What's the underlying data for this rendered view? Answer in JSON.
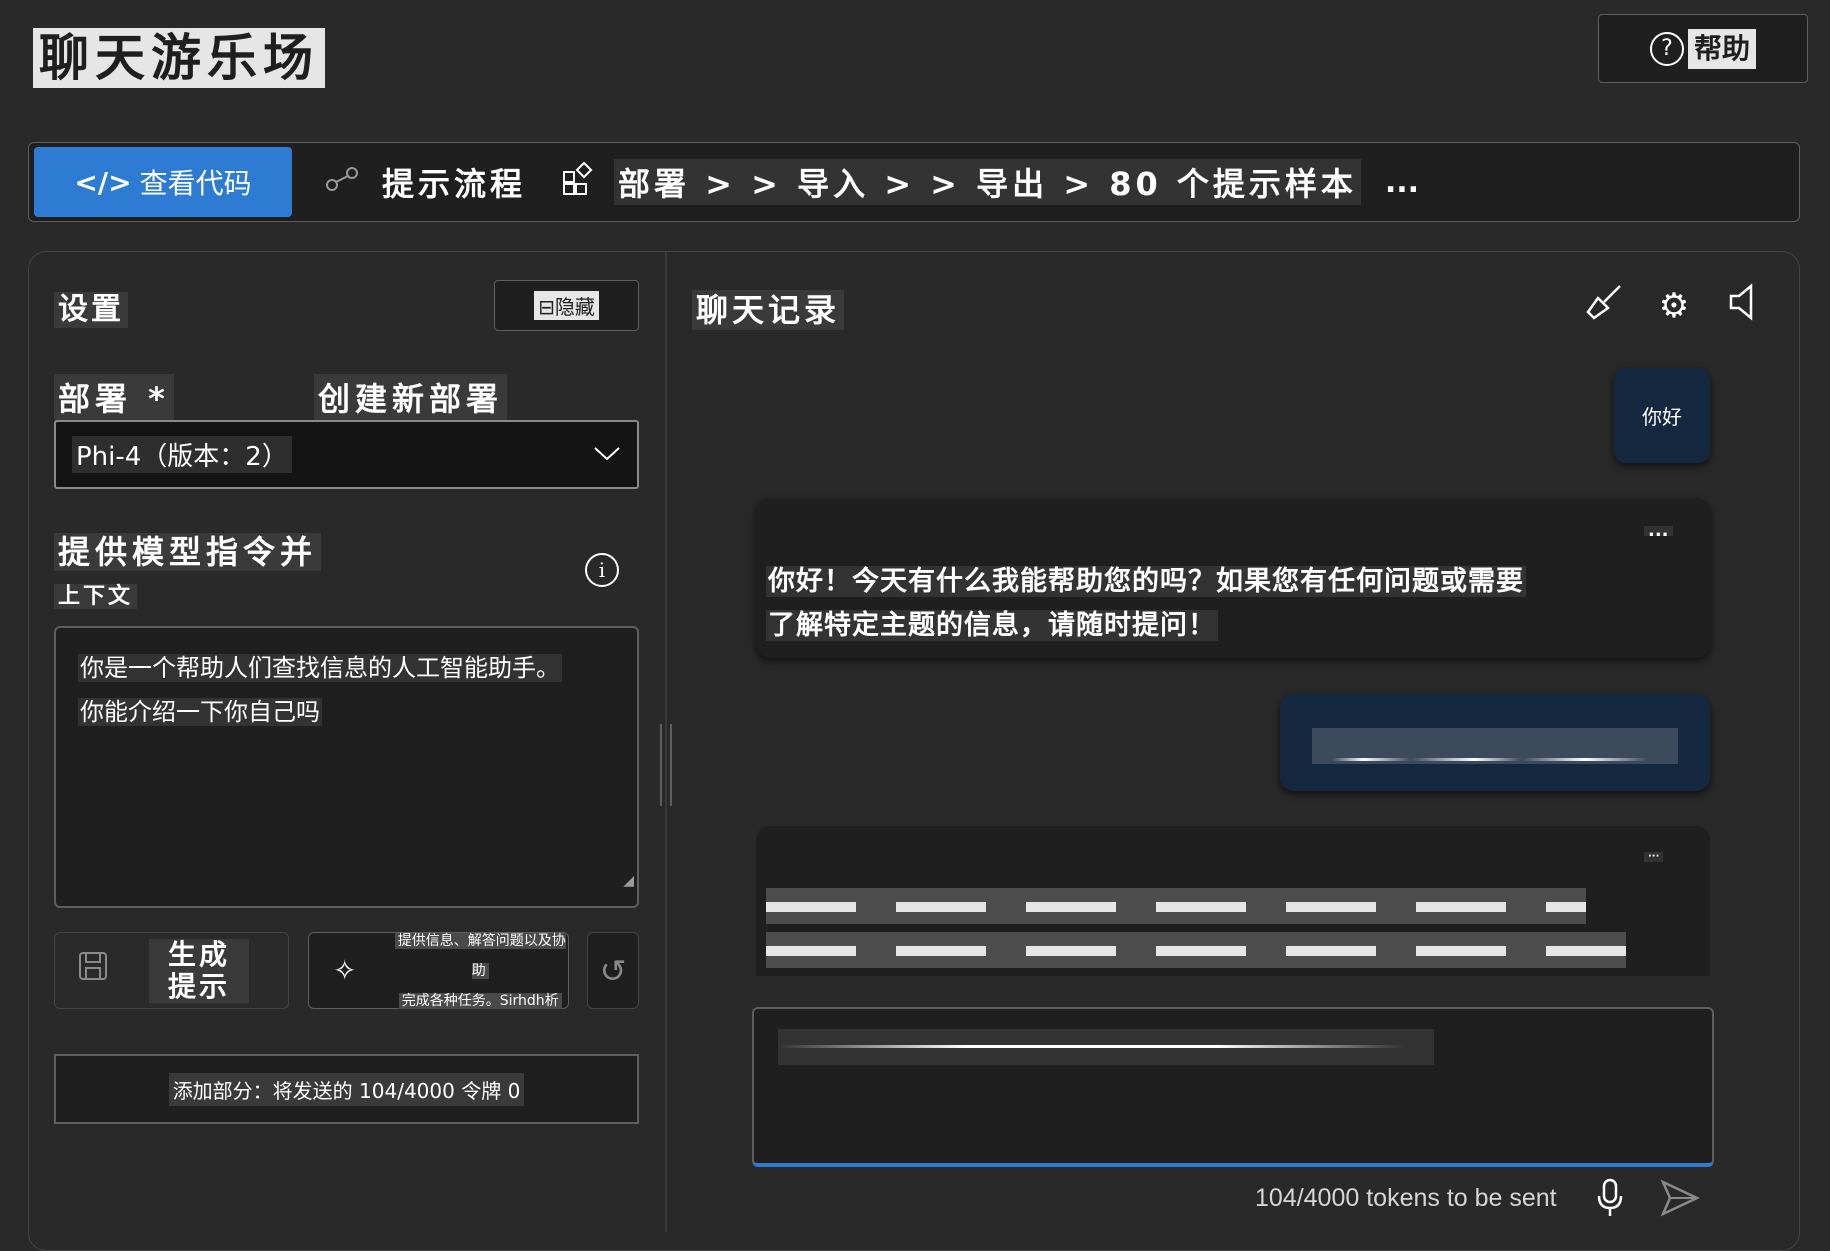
{
  "header": {
    "title": "聊天游乐场",
    "help_label": "帮助"
  },
  "toolbar": {
    "view_code_label": "查看代码",
    "code_glyph": "</>",
    "prompt_flow_label": "提示流程",
    "deploy_chain_label": "部署 > > 导入 > > 导出 > 80 个提示样本",
    "more_label": "..."
  },
  "settings": {
    "title": "设置",
    "hide_label": "隐藏",
    "deployment_label": "部署 *",
    "create_deployment_label": "创建新部署",
    "deployment_value": "Phi-4（版本：2）",
    "instructions_label": "提供模型指令并",
    "instructions_sublabel": "上下文",
    "system_message_line1": "你是一个帮助人们查找信息的人工智能助手。",
    "system_message_line2": "你能介绍一下你自己吗",
    "generate_label_line1": "生成",
    "generate_label_line2": "提示",
    "suggest_line1": "提供信息、解答问题以及协助",
    "suggest_line2": "完成各种任务。Sirhdh析",
    "token_summary": "添加部分：将发送的 104/4000 令牌 0"
  },
  "chat": {
    "title": "聊天记录",
    "user_message_1": "你好",
    "assistant_message_1_line1": "你好！今天有什么我能帮助您的吗？如果您有任何问题或需要",
    "assistant_message_1_line2": "了解特定主题的信息，请随时提问！",
    "assistant_more": "...",
    "token_counter": "104/4000 tokens to be sent"
  },
  "icons": {
    "help": "help-circle-icon",
    "code": "code-icon",
    "prompt_flow": "flow-icon",
    "deploy": "apps-icon",
    "hide": "minus-square-icon",
    "chevron": "chevron-down-icon",
    "info": "info-icon",
    "save": "save-icon",
    "sparkle": "sparkle-icon",
    "reset": "undo-icon",
    "clear": "broom-icon",
    "settings": "gear-icon",
    "speaker": "speaker-icon",
    "mic": "microphone-icon",
    "send": "send-icon"
  },
  "colors": {
    "accent": "#2d7bd3",
    "background": "#292929",
    "user_bubble": "#142840",
    "assistant_bubble": "#1f1f1f"
  }
}
